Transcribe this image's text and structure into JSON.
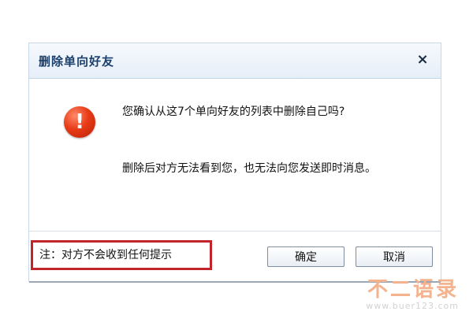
{
  "dialog": {
    "title": "删除单向好友",
    "close_glyph": "×",
    "icon": "exclamation-alert-icon",
    "message_1": "您确认从这7个单向好友的列表中删除自己吗?",
    "message_2": "删除后对方无法看到您，也无法向您发送即时消息。",
    "note": "注：对方不会收到任何提示",
    "buttons": {
      "ok_label": "确定",
      "cancel_label": "取消"
    }
  },
  "watermark": {
    "title": "不二语录",
    "url": "www.buer123.com"
  }
}
